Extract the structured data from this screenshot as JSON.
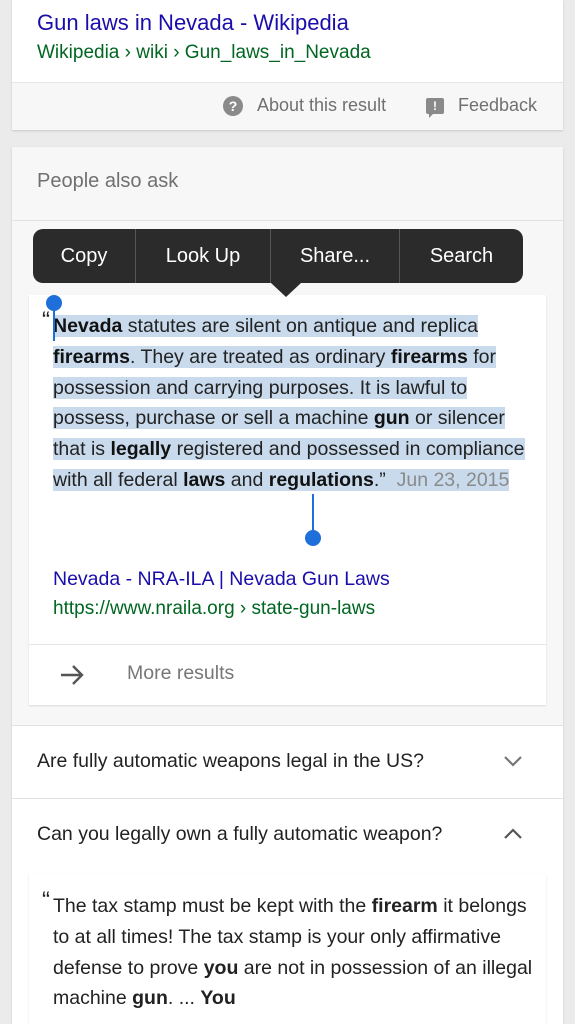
{
  "top_result": {
    "title": "Gun laws in Nevada - Wikipedia",
    "url": "Wikipedia › wiki › Gun_laws_in_Nevada",
    "about_label": "About this result",
    "feedback_label": "Feedback"
  },
  "paa": {
    "heading": "People also ask",
    "answer1": {
      "w1": "Nevada",
      "t1": " statutes are silent on antique and replica ",
      "w2": "firearms",
      "t2": ". They are treated as ordinary ",
      "w3": "firearms",
      "t3": " for possession and carrying purposes. It is lawful to possess, purchase or sell a machine ",
      "w4": "gun",
      "t4": " or silencer that is ",
      "w5": "legally",
      "t5": " registered and possessed in compliance with all federal ",
      "w6": "laws",
      "t6": " and ",
      "w7": "regulations",
      "t7": ".”",
      "date": "Jun 23, 2015",
      "source_title": "Nevada - NRA-ILA | Nevada Gun Laws",
      "source_url": "https://www.nraila.org › state-gun-laws",
      "more_label": "More results"
    },
    "question2": "Are fully automatic weapons legal in the US?",
    "question3": "Can you legally own a fully automatic weapon?",
    "answer3": {
      "t1": "The tax stamp must be kept with the ",
      "w1": "firearm",
      "t2": " it belongs to at all times! The tax stamp is your only affirmative defense to prove ",
      "w2": "you",
      "t3": " are not in possession of an illegal machine ",
      "w3": "gun",
      "t4": ". ... ",
      "w4": "You"
    }
  },
  "context_menu": {
    "items": [
      "Copy",
      "Look Up",
      "Share...",
      "Search"
    ]
  },
  "icons": {
    "help": "question-circle-icon",
    "feedback": "feedback-icon",
    "more": "arrow-right-icon",
    "expand": "chevron-down-icon",
    "collapse": "chevron-up-icon"
  },
  "colors": {
    "link": "#1a0dab",
    "url": "#006621",
    "selection": "#c8daec",
    "handle": "#1e6fd9",
    "menu_bg": "#2b2b2b"
  }
}
